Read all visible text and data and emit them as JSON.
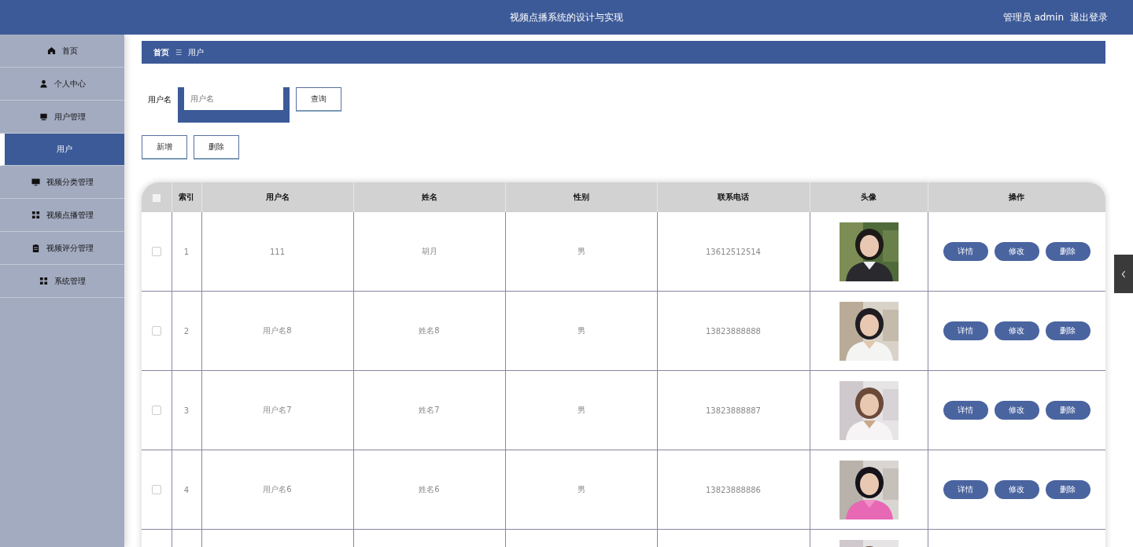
{
  "header": {
    "title": "视频点播系统的设计与实现",
    "user": "管理员 admin",
    "logout": "退出登录"
  },
  "sidebar": {
    "items": [
      {
        "label": "首页",
        "selected": false
      },
      {
        "label": "个人中心",
        "selected": false
      },
      {
        "label": "用户管理",
        "selected": false
      },
      {
        "label": "用户",
        "selected": true
      },
      {
        "label": "视频分类管理",
        "selected": false
      },
      {
        "label": "视频点播管理",
        "selected": false
      },
      {
        "label": "视频评分管理",
        "selected": false
      },
      {
        "label": "系统管理",
        "selected": false
      }
    ]
  },
  "breadcrumb": {
    "home": "首页",
    "separator": "☰",
    "current": "用户"
  },
  "search": {
    "label": "用户名",
    "placeholder": "用户名",
    "button": "查询"
  },
  "actions": [
    "新增",
    "删除"
  ],
  "table": {
    "select_all": {
      "checked": false
    },
    "columns": [
      "索引",
      "用户名",
      "姓名",
      "性别",
      "联系电话",
      "头像",
      "操作"
    ],
    "rows": [
      {
        "checked": false,
        "index": "1",
        "username": "111",
        "name": "胡月",
        "gender": "男",
        "phone": "13612512514",
        "avatar": {
          "kind": "picture"
        },
        "buttons": [
          "详情",
          "修改",
          "删除"
        ]
      },
      {
        "checked": false,
        "index": "2",
        "username": "用户名8",
        "name": "姓名8",
        "gender": "男",
        "phone": "13823888888",
        "avatar": {
          "kind": "picture"
        },
        "buttons": [
          "详情",
          "修改",
          "删除"
        ]
      },
      {
        "checked": false,
        "index": "3",
        "username": "用户名7",
        "name": "姓名7",
        "gender": "男",
        "phone": "13823888887",
        "avatar": {
          "kind": "picture"
        },
        "buttons": [
          "详情",
          "修改",
          "删除"
        ]
      },
      {
        "checked": false,
        "index": "4",
        "username": "用户名6",
        "name": "姓名6",
        "gender": "男",
        "phone": "13823888886",
        "avatar": {
          "kind": "picture"
        },
        "buttons": [
          "详情",
          "修改",
          "删除"
        ]
      },
      {
        "avatar": {
          "kind": "picture"
        }
      }
    ]
  }
}
